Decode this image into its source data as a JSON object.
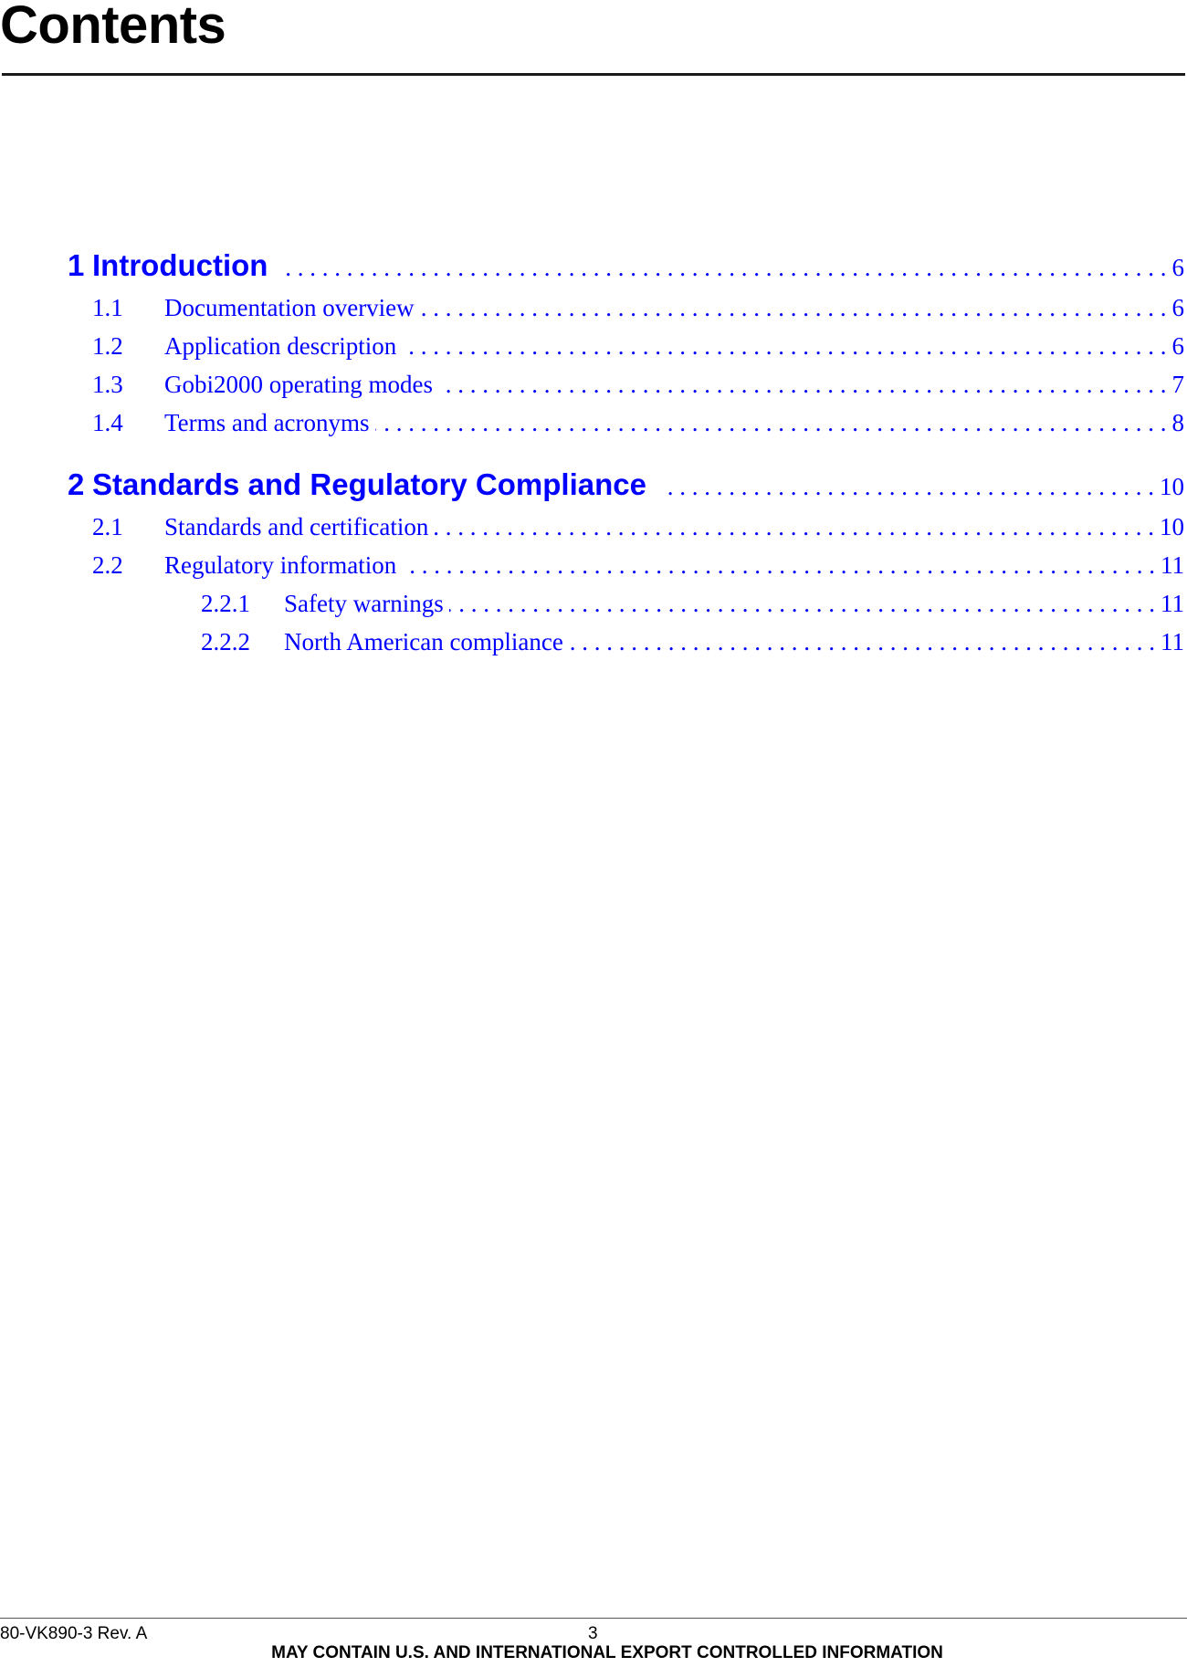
{
  "page": {
    "title": "Contents",
    "link_color": "#0000ff"
  },
  "toc": [
    {
      "level": 1,
      "number": "1",
      "label": "Introduction",
      "page": "6"
    },
    {
      "level": 2,
      "number": "1.1",
      "label": "Documentation overview",
      "page": "6"
    },
    {
      "level": 2,
      "number": "1.2",
      "label": "Application description",
      "page": "6"
    },
    {
      "level": 2,
      "number": "1.3",
      "label": "Gobi2000 operating modes",
      "page": "7"
    },
    {
      "level": 2,
      "number": "1.4",
      "label": "Terms and acronyms",
      "page": "8"
    },
    {
      "level": 1,
      "number": "2",
      "label": "Standards and Regulatory Compliance",
      "page": "10"
    },
    {
      "level": 2,
      "number": "2.1",
      "label": "Standards and certification",
      "page": "10"
    },
    {
      "level": 2,
      "number": "2.2",
      "label": "Regulatory information",
      "page": "11"
    },
    {
      "level": 3,
      "number": "2.2.1",
      "label": "Safety warnings",
      "page": "11"
    },
    {
      "level": 3,
      "number": "2.2.2",
      "label": "North American compliance",
      "page": "11"
    }
  ],
  "footer": {
    "doc_id": "80-VK890-3 Rev. A",
    "page_number": "3",
    "notice": "MAY CONTAIN U.S. AND INTERNATIONAL EXPORT CONTROLLED INFORMATION"
  }
}
